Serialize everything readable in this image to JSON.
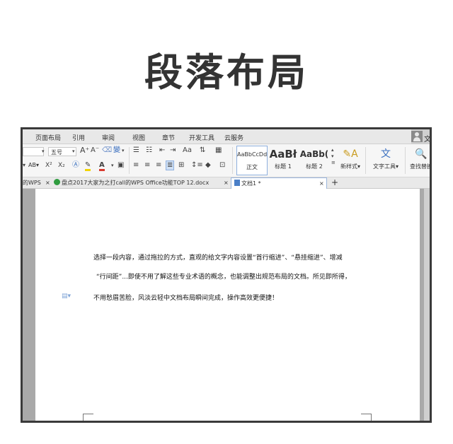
{
  "headline": "段落布局",
  "menu": {
    "items": [
      "页面布局",
      "引用",
      "审阅",
      "视图",
      "章节",
      "开发工具",
      "云服务"
    ],
    "user_label": "文"
  },
  "toolbar": {
    "font_size": "五号",
    "grow_font": "A⁺",
    "shrink_font": "A⁻",
    "ab_label": "AB",
    "superscript": "X²",
    "subscript": "X₂",
    "styles": [
      {
        "sample": "AaBbCcDd",
        "name": "正文"
      },
      {
        "sample": "AaBł",
        "name": "标题 1"
      },
      {
        "sample": "AaBb(",
        "name": "标题 2"
      }
    ],
    "new_style": "新样式",
    "text_tools": "文字工具",
    "find_replace": "查找替换"
  },
  "tabs": [
    {
      "label": "的WPS",
      "close": "×"
    },
    {
      "label": "盘点2017大家为之打call的WPS Office功能TOP 12.docx",
      "close": "×"
    },
    {
      "label": "文档1 *",
      "close": "×"
    }
  ],
  "new_tab": "+",
  "document": {
    "lines": [
      "选择一段内容，通过拖拉的方式，直观的给文字内容设置“首行缩进”、“悬挂缩进”、增减",
      "“行间距”...即使不用了解这些专业术语的概念，也能调整出规范布局的文档。所见即所得，",
      "不用愁眉苦脸，风淡云轻中文档布局瞬间完成，操作高效更便捷！"
    ]
  },
  "colors": {
    "headline": "#333333",
    "frame": "#3a3a3a",
    "menu_bg": "#e8e8e8",
    "toolbar_bg": "#f6f6f6",
    "workspace": "#a9a9a9",
    "font_color_red": "#d83a2f",
    "highlight_yellow": "#f2d300",
    "accent_blue": "#4a7fc8"
  }
}
